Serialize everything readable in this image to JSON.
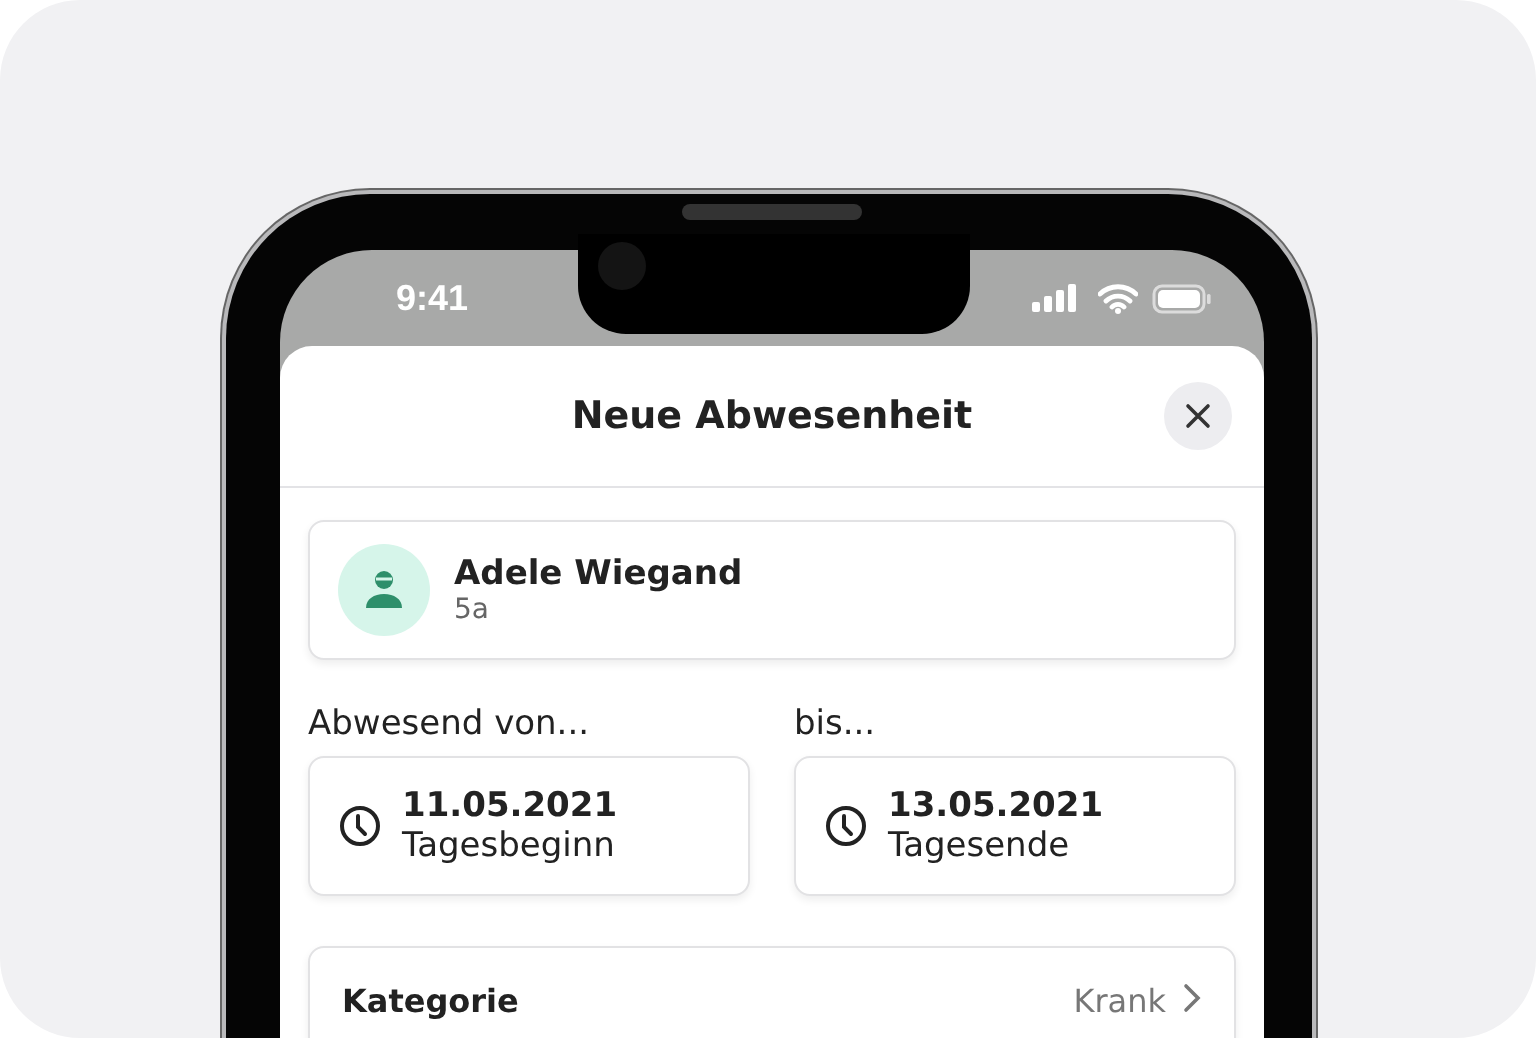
{
  "status_bar": {
    "time": "9:41"
  },
  "sheet": {
    "title": "Neue Abwesenheit"
  },
  "student": {
    "name": "Adele Wiegand",
    "class": "5a"
  },
  "period": [
    {
      "label": "Abwesend von...",
      "date": "11.05.2021",
      "time": "Tagesbeginn"
    },
    {
      "label": "bis...",
      "date": "13.05.2021",
      "time": "Tagesende"
    }
  ],
  "category": {
    "label": "Kategorie",
    "value": "Krank"
  }
}
